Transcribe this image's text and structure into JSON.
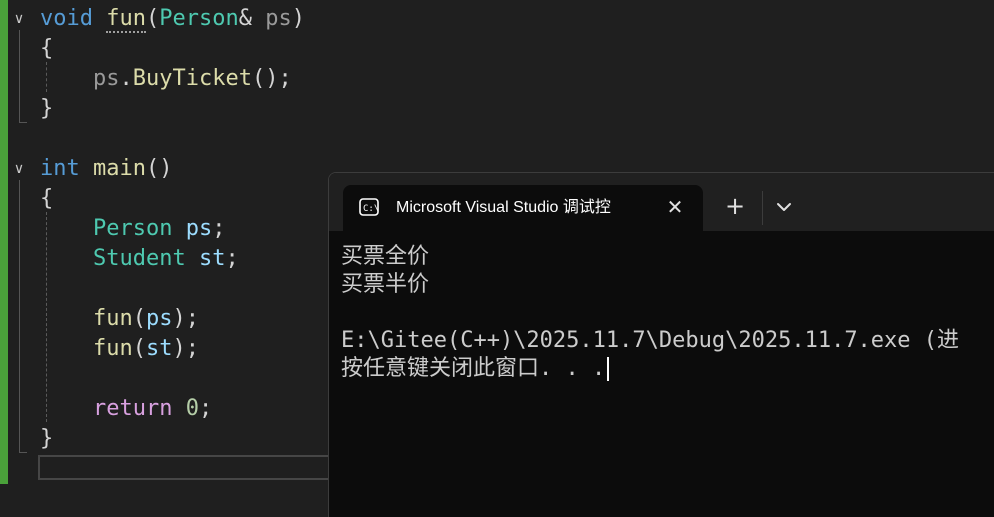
{
  "editor": {
    "lines": {
      "l1": {
        "kw": "void",
        "fn": "fun",
        "open": "(",
        "type": "Person",
        "amp": "&",
        "param": "ps",
        "close": ")"
      },
      "l2": {
        "text": "{"
      },
      "l3": {
        "obj": "ps",
        "dot": ".",
        "method": "BuyTicket",
        "rest": "();"
      },
      "l4": {
        "text": "}"
      },
      "l6": {
        "kw": "int",
        "fn": "main",
        "rest": "()"
      },
      "l7": {
        "text": "{"
      },
      "l8": {
        "type": "Person",
        "var": "ps",
        "semi": ";"
      },
      "l9": {
        "type": "Student",
        "var": "st",
        "semi": ";"
      },
      "l11": {
        "fn": "fun",
        "open": "(",
        "arg": "ps",
        "close": ");"
      },
      "l12": {
        "fn": "fun",
        "open": "(",
        "arg": "st",
        "close": ");"
      },
      "l14": {
        "kw": "return",
        "num": "0",
        "semi": ";"
      },
      "l15": {
        "text": "}"
      }
    },
    "fold_glyph": "∨"
  },
  "terminal": {
    "tab_title": "Microsoft Visual Studio 调试控",
    "tab_icon": "console-icon",
    "close_glyph": "✕",
    "plus_glyph": "+",
    "output": [
      "买票全价",
      "买票半价",
      "",
      "E:\\Gitee(C++)\\2025.11.7\\Debug\\2025.11.7.exe (进",
      "按任意键关闭此窗口. . ."
    ]
  },
  "colors": {
    "change_bar": "#4aa13a",
    "keyword": "#569cd6",
    "control_keyword": "#d8a0df",
    "function": "#dcdcaa",
    "type": "#4ec9b0",
    "variable": "#9cdcfe",
    "terminal_bg": "#0c0c0c"
  }
}
